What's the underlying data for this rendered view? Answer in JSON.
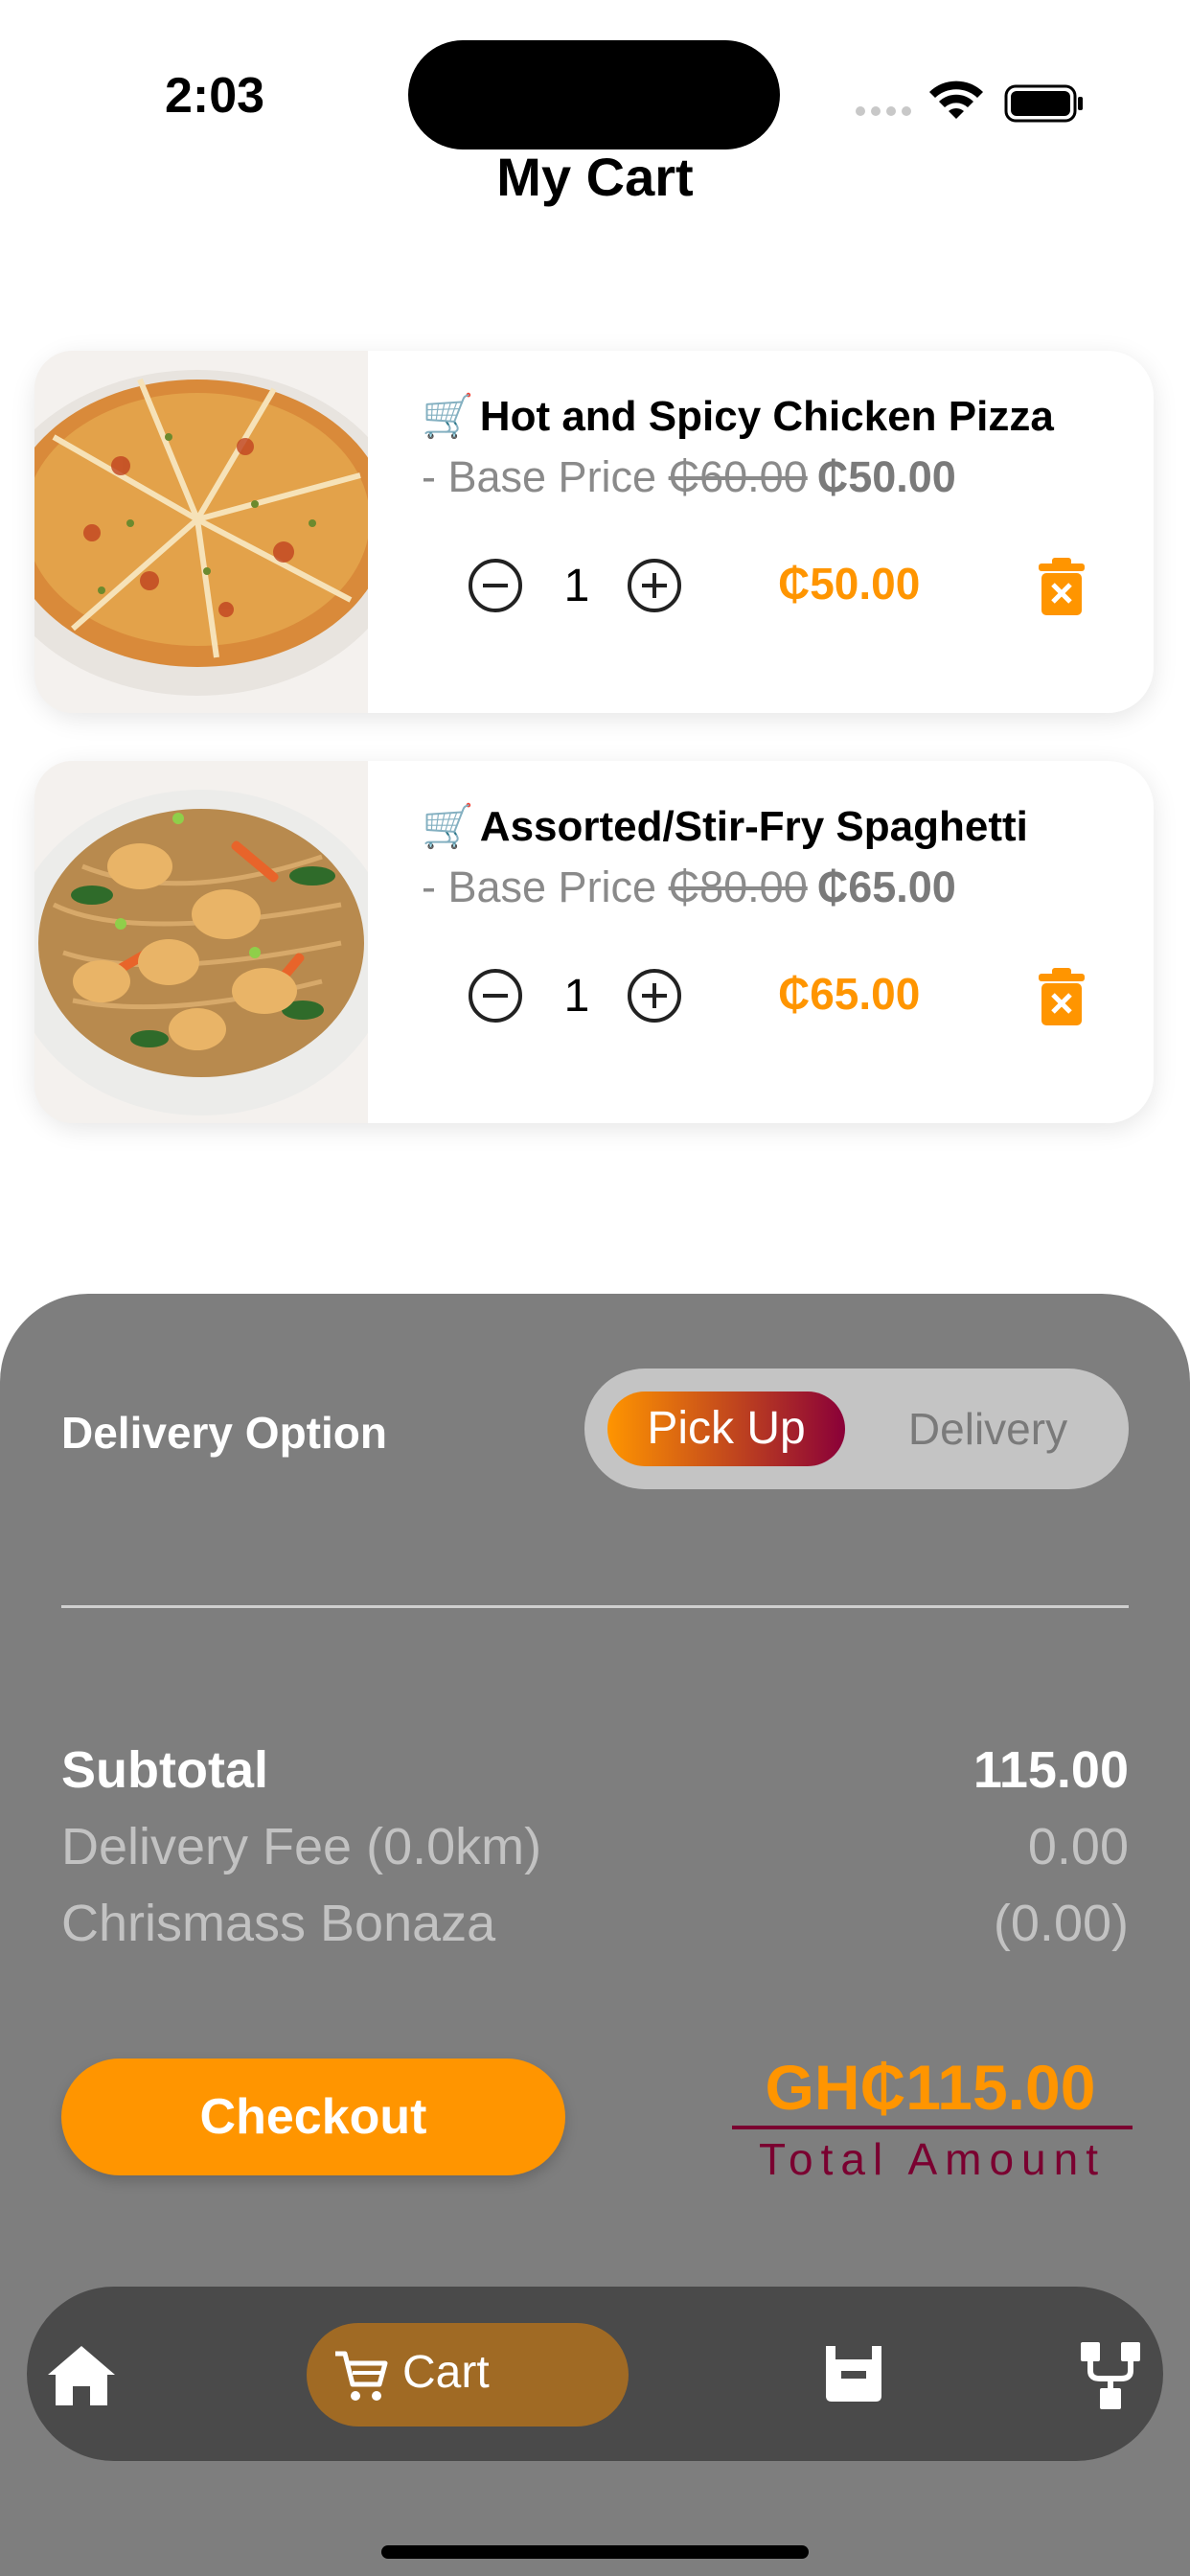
{
  "status_bar": {
    "time": "2:03"
  },
  "header": {
    "title": "My Cart"
  },
  "cart_items": [
    {
      "emoji": "🛒",
      "name": "Hot and Spicy Chicken Pizza",
      "base_price_prefix": "- Base Price",
      "old_price": "₵60.00",
      "new_price": "₵50.00",
      "quantity": "1",
      "line_total": "₵50.00"
    },
    {
      "emoji": "🛒",
      "name": "Assorted/Stir-Fry Spaghetti",
      "base_price_prefix": "- Base Price",
      "old_price": "₵80.00",
      "new_price": "₵65.00",
      "quantity": "1",
      "line_total": "₵65.00"
    }
  ],
  "checkout_sheet": {
    "delivery_option_label": "Delivery Option",
    "toggle": {
      "selected": "Pick Up",
      "other": "Delivery"
    },
    "rows": [
      {
        "label": "Subtotal",
        "value": "115.00"
      },
      {
        "label": "Delivery Fee (0.0km)",
        "value": "0.00"
      },
      {
        "label": "Chrismass Bonaza",
        "value": "(0.00)"
      }
    ],
    "checkout_label": "Checkout",
    "total_amount": "GH₵115.00",
    "total_label": "Total Amount"
  },
  "bottom_nav": {
    "items": [
      {
        "name": "home",
        "icon": "home-icon",
        "label": ""
      },
      {
        "name": "cart",
        "icon": "cart-icon",
        "label": "Cart",
        "active": true
      },
      {
        "name": "orders",
        "icon": "basket-icon",
        "label": ""
      },
      {
        "name": "track",
        "icon": "route-icon",
        "label": ""
      }
    ]
  },
  "colors": {
    "accent": "#ff9500",
    "maroon": "#7a0030",
    "sheet": "#7e7e7e",
    "nav": "#4a4a4a"
  }
}
